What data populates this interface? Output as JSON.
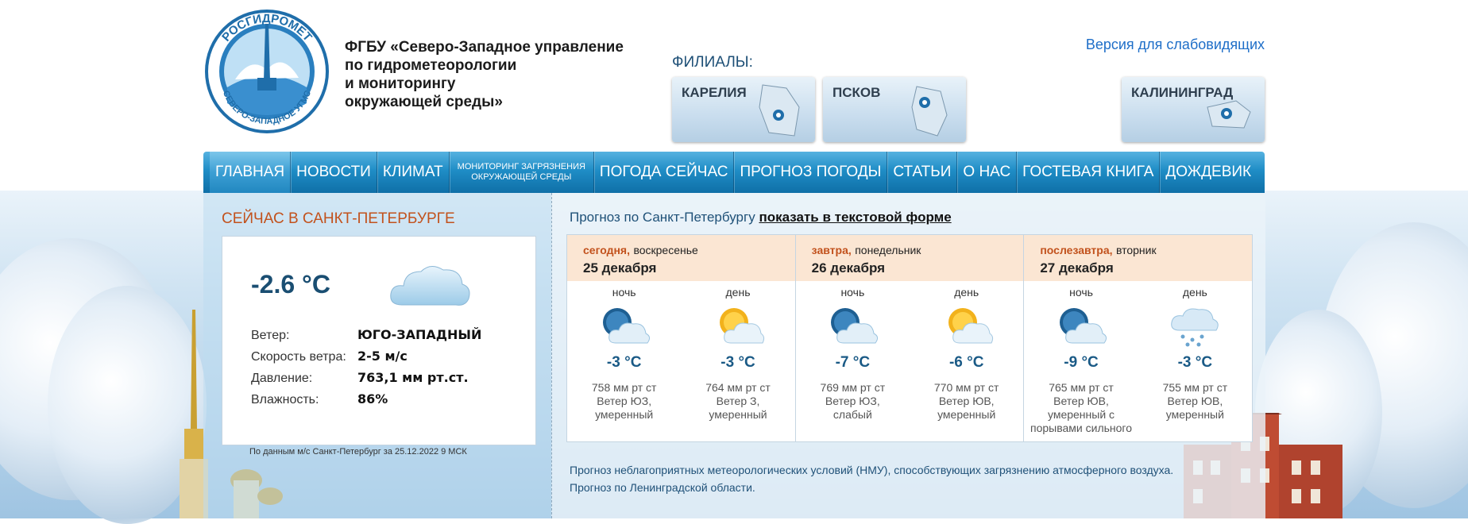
{
  "header": {
    "logo_text_top": "РОСГИДРОМЕТ",
    "logo_text_bottom": "СЕВЕРО-ЗАПАДНОЕ УГМС",
    "org_line1": "ФГБУ «Северо-Западное управление",
    "org_line2": "по гидрометеорологии",
    "org_line3": "и мониторингу",
    "org_line4": "окружающей среды»",
    "accessibility_link": "Версия для слабовидящих",
    "branches_label": "ФИЛИАЛЫ:",
    "branches": [
      "КАРЕЛИЯ",
      "ПСКОВ",
      "КАЛИНИНГРАД"
    ]
  },
  "nav": {
    "items": [
      "ГЛАВНАЯ",
      "НОВОСТИ",
      "КЛИМАТ",
      "МОНИТОРИНГ ЗАГРЯЗНЕНИЯ",
      "ПОГОДА СЕЙЧАС",
      "ПРОГНОЗ ПОГОДЫ",
      "СТАТЬИ",
      "О НАС",
      "ГОСТЕВАЯ КНИГА",
      "ДОЖДЕВИК"
    ],
    "monitoring_line2": "ОКРУЖАЮЩЕЙ СРЕДЫ",
    "active_index": 0
  },
  "current": {
    "title": "СЕЙЧАС В САНКТ-ПЕТЕРБУРГЕ",
    "temperature": "-2.6 °C",
    "icon": "cloud-icon",
    "wind_label": "Ветер:",
    "wind_value": "ЮГО-ЗАПАДНЫЙ",
    "speed_label": "Скорость ветра:",
    "speed_value": "2-5 м/с",
    "pressure_label": "Давление:",
    "pressure_value": "763,1 мм рт.ст.",
    "humidity_label": "Влажность:",
    "humidity_value": "86%",
    "source": "По данным м/с Санкт-Петербург за 25.12.2022 9 МСК"
  },
  "forecast": {
    "title_prefix": "Прогноз по Санкт-Петербургу",
    "title_link": "показать в текстовой форме",
    "days": [
      {
        "rel": "сегодня,",
        "weekday": "воскресенье",
        "date": "25 декабря",
        "periods": [
          {
            "name": "ночь",
            "icon": "night-cloudy-icon",
            "temp": "-3 °C",
            "desc1": "758 мм рт ст",
            "desc2": "Ветер ЮЗ,",
            "desc3": "умеренный",
            "desc4": ""
          },
          {
            "name": "день",
            "icon": "sun-cloudy-icon",
            "temp": "-3 °C",
            "desc1": "764 мм рт ст",
            "desc2": "Ветер З,",
            "desc3": "умеренный",
            "desc4": ""
          }
        ]
      },
      {
        "rel": "завтра,",
        "weekday": "понедельник",
        "date": "26 декабря",
        "periods": [
          {
            "name": "ночь",
            "icon": "night-cloudy-icon",
            "temp": "-7 °C",
            "desc1": "769 мм рт ст",
            "desc2": "Ветер ЮЗ,",
            "desc3": "слабый",
            "desc4": ""
          },
          {
            "name": "день",
            "icon": "sun-cloudy-icon",
            "temp": "-6 °C",
            "desc1": "770 мм рт ст",
            "desc2": "Ветер ЮВ,",
            "desc3": "умеренный",
            "desc4": ""
          }
        ]
      },
      {
        "rel": "послезавтра,",
        "weekday": "вторник",
        "date": "27 декабря",
        "periods": [
          {
            "name": "ночь",
            "icon": "night-cloudy-icon",
            "temp": "-9 °C",
            "desc1": "765 мм рт ст",
            "desc2": "Ветер ЮВ,",
            "desc3": "умеренный с",
            "desc4": "порывами сильного"
          },
          {
            "name": "день",
            "icon": "snow-cloud-icon",
            "temp": "-3 °C",
            "desc1": "755 мм рт ст",
            "desc2": "Ветер ЮВ,",
            "desc3": "умеренный",
            "desc4": ""
          }
        ]
      }
    ]
  },
  "links": {
    "nmu": "Прогноз неблагоприятных метеорологических условий (НМУ), способствующих загрязнению атмосферного воздуха.",
    "region": "Прогноз по Ленинградской области."
  }
}
